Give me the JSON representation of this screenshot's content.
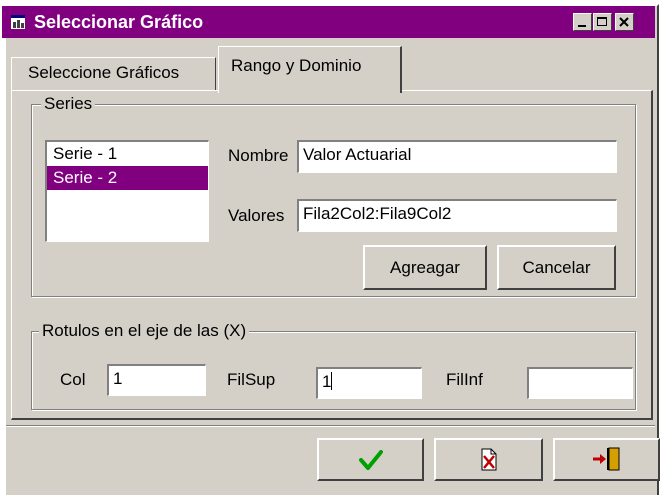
{
  "window": {
    "title": "Seleccionar Gráfico",
    "controls": [
      "minimize",
      "maximize",
      "close"
    ]
  },
  "tabs": [
    {
      "label": "Seleccione Gráficos",
      "active": false
    },
    {
      "label": "Rango y Dominio",
      "active": true
    }
  ],
  "series_group": {
    "title": "Series",
    "items": [
      {
        "label": "Serie - 1",
        "selected": false
      },
      {
        "label": "Serie - 2",
        "selected": true
      }
    ],
    "nombre_label": "Nombre",
    "nombre_value": "Valor Actuarial",
    "valores_label": "Valores",
    "valores_value": "Fila2Col2:Fila9Col2",
    "add_button": "Agreagar",
    "cancel_button": "Cancelar"
  },
  "rotulos_group": {
    "title": "Rotulos en el eje de las (X)",
    "col_label": "Col",
    "col_value": "1",
    "filsup_label": "FilSup",
    "filsup_value": "1",
    "filinf_label": "FilInf",
    "filinf_value": ""
  },
  "footer_buttons": [
    {
      "icon": "checkmark-icon"
    },
    {
      "icon": "document-cancel-icon"
    },
    {
      "icon": "exit-door-icon"
    }
  ],
  "colors": {
    "titlebar": "#800080",
    "selection": "#800080",
    "face": "#d4d0c8",
    "check_green": "#00a000",
    "icon_red": "#c00000"
  }
}
